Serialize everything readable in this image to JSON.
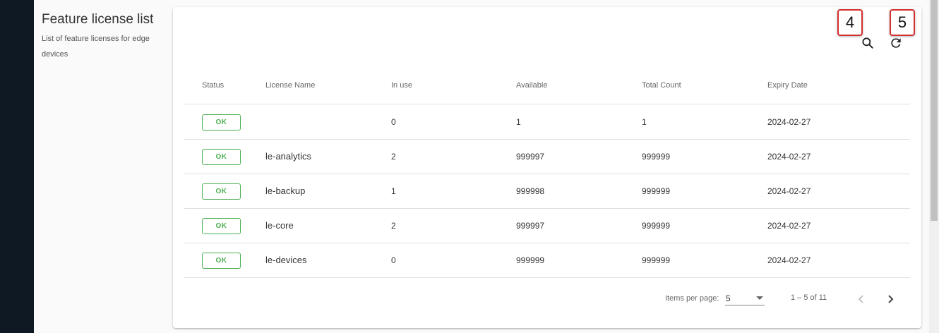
{
  "side": {
    "title": "Feature license list",
    "description": "List of feature licenses for edge devices"
  },
  "callouts": {
    "first": "4",
    "second": "5"
  },
  "toolbar": {
    "search_icon": "search-icon",
    "refresh_icon": "refresh-icon"
  },
  "table": {
    "headers": [
      "Status",
      "License Name",
      "In use",
      "Available",
      "Total Count",
      "Expiry Date"
    ],
    "rows": [
      {
        "status": "OK",
        "name": "",
        "in_use": "0",
        "available": "1",
        "total": "1",
        "expiry": "2024-02-27"
      },
      {
        "status": "OK",
        "name": "le-analytics",
        "in_use": "2",
        "available": "999997",
        "total": "999999",
        "expiry": "2024-02-27"
      },
      {
        "status": "OK",
        "name": "le-backup",
        "in_use": "1",
        "available": "999998",
        "total": "999999",
        "expiry": "2024-02-27"
      },
      {
        "status": "OK",
        "name": "le-core",
        "in_use": "2",
        "available": "999997",
        "total": "999999",
        "expiry": "2024-02-27"
      },
      {
        "status": "OK",
        "name": "le-devices",
        "in_use": "0",
        "available": "999999",
        "total": "999999",
        "expiry": "2024-02-27"
      }
    ]
  },
  "paginator": {
    "items_per_page_label": "Items per page:",
    "items_per_page_value": "5",
    "range_label": "1 – 5 of 11"
  },
  "colors": {
    "status_ok": "#4caf50",
    "callout_border": "#d32f2f",
    "sidebar": "#0f1923"
  }
}
